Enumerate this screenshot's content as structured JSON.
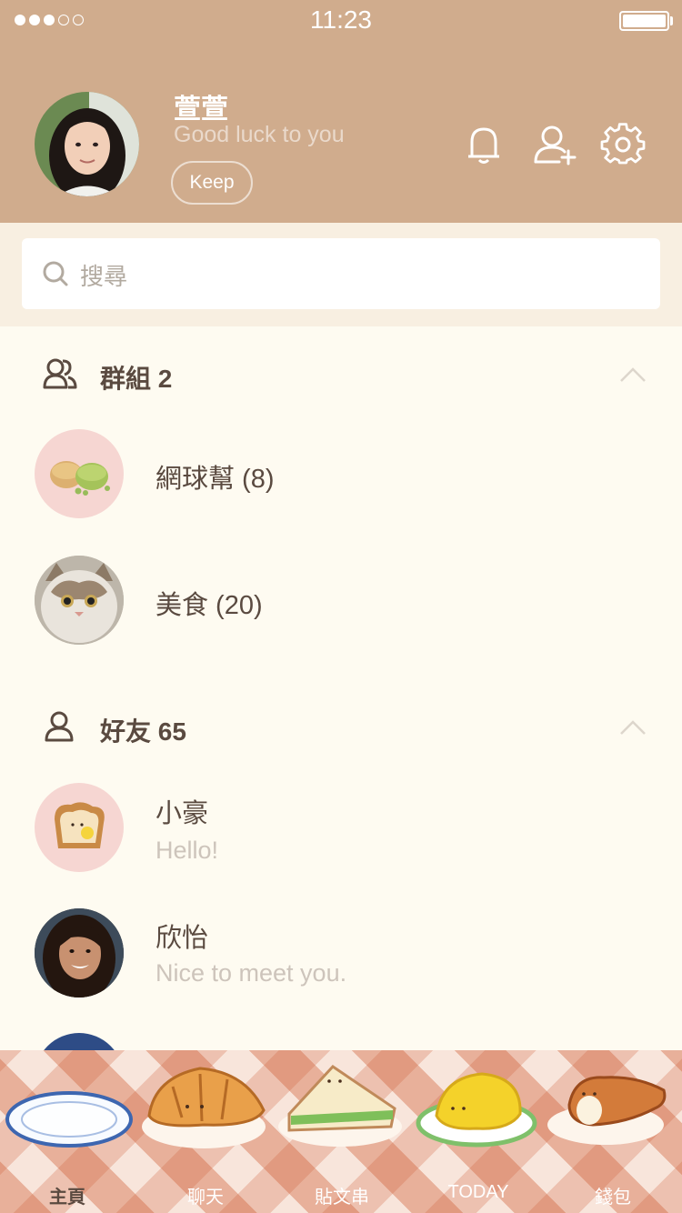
{
  "status_bar": {
    "time": "11:23",
    "signal_full": 3,
    "signal_total": 5
  },
  "profile": {
    "name": "萱萱",
    "status": "Good luck to you",
    "keep_label": "Keep"
  },
  "header_icons": [
    "bell-icon",
    "add-friend-icon",
    "gear-icon"
  ],
  "search": {
    "placeholder": "搜尋"
  },
  "groups": {
    "title": "群組 2",
    "items": [
      {
        "name": "網球幫 (8)",
        "avatar": "macaron-avatar"
      },
      {
        "name": "美食 (20)",
        "avatar": "cat-avatar"
      }
    ]
  },
  "friends": {
    "title": "好友 65",
    "items": [
      {
        "name": "小豪",
        "status": "Hello!",
        "avatar": "toast-avatar"
      },
      {
        "name": "欣怡",
        "status": "Nice to meet you.",
        "avatar": "woman-avatar"
      }
    ]
  },
  "tabs": [
    {
      "label": "主頁",
      "active": true
    },
    {
      "label": "聊天",
      "active": false
    },
    {
      "label": "貼文串",
      "active": false
    },
    {
      "label": "TODAY",
      "active": false
    },
    {
      "label": "錢包",
      "active": false
    }
  ],
  "colors": {
    "header": "#d0ac8d",
    "background": "#fefbf1",
    "text": "#5a4a40",
    "muted": "#cdc4bb"
  }
}
